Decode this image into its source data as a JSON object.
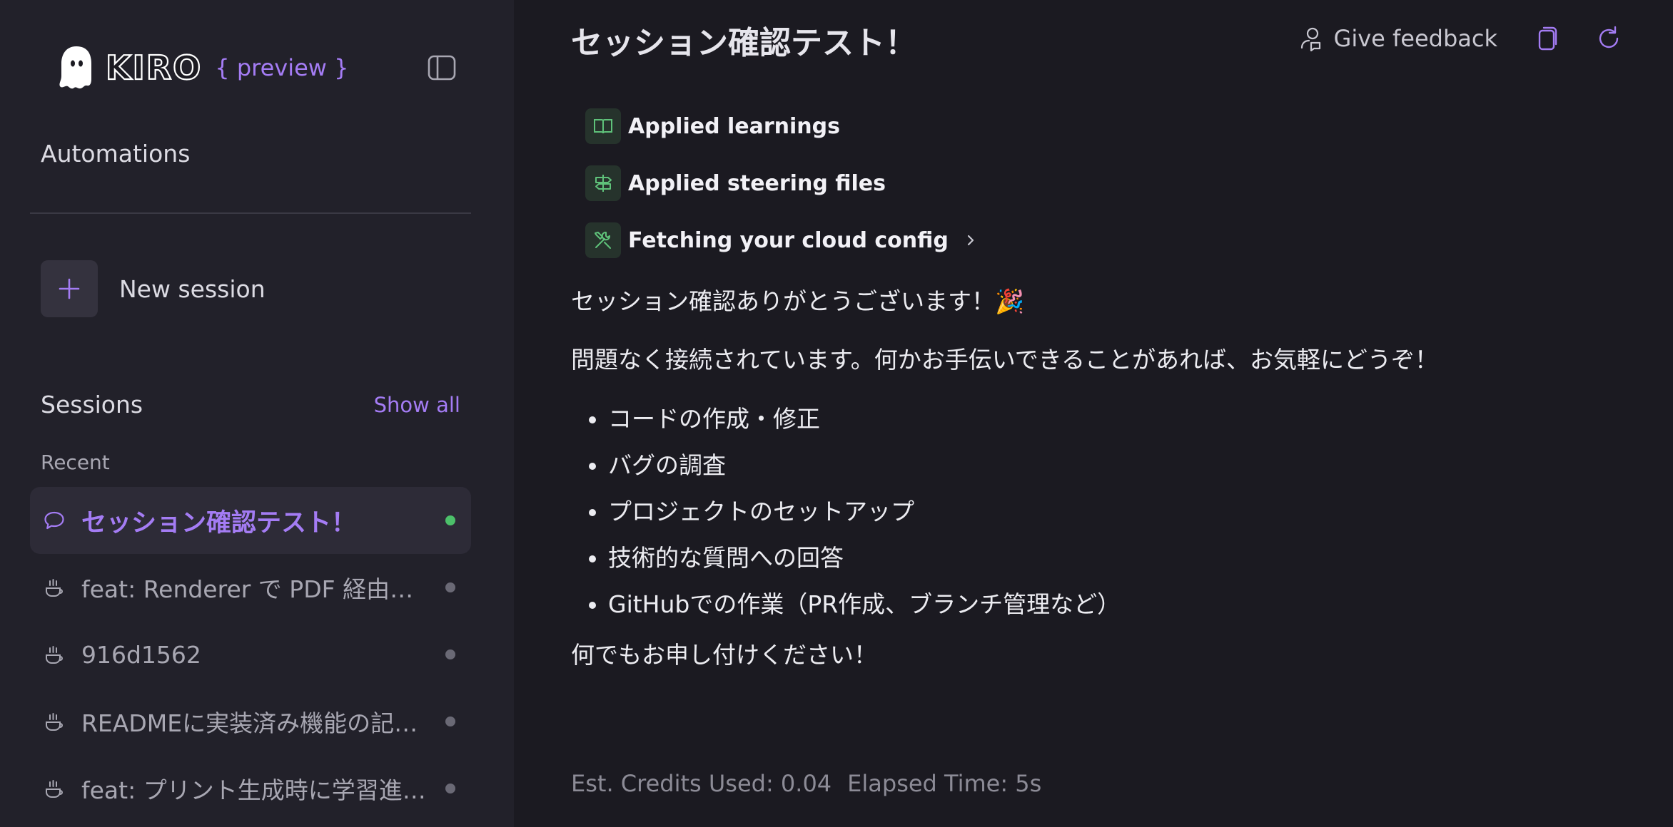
{
  "sidebar": {
    "brand": {
      "name": "KIRO",
      "tag": "{ preview }"
    },
    "automations_label": "Automations",
    "new_session_label": "New session",
    "sessions_title": "Sessions",
    "show_all_label": "Show all",
    "recent_label": "Recent",
    "sessions": [
      {
        "title": "セッション確認テスト！",
        "icon": "chat-bubble-icon",
        "active": true,
        "status": "green"
      },
      {
        "title": "feat: Renderer で PDF 経由の …",
        "icon": "steaming-cup-icon",
        "active": false,
        "status": "gray"
      },
      {
        "title": "916d1562",
        "icon": "steaming-cup-icon",
        "active": false,
        "status": "gray"
      },
      {
        "title": "READMEに実装済み機能の記…",
        "icon": "steaming-cup-icon",
        "active": false,
        "status": "gray"
      },
      {
        "title": "feat: プリント生成時に学習進…",
        "icon": "steaming-cup-icon",
        "active": false,
        "status": "gray"
      }
    ]
  },
  "main": {
    "title": "セッション確認テスト！",
    "feedback_label": "Give feedback",
    "steps": [
      {
        "label": "Applied learnings",
        "icon": "book-icon"
      },
      {
        "label": "Applied steering files",
        "icon": "signpost-icon"
      },
      {
        "label": "Fetching your cloud config",
        "icon": "tools-icon",
        "expandable": true
      }
    ],
    "message": {
      "line1": "セッション確認ありがとうございます！🎉",
      "line2": "問題なく接続されています。何かお手伝いできることがあれば、お気軽にどうぞ！",
      "bullets": [
        "コードの作成・修正",
        "バグの調査",
        "プロジェクトのセットアップ",
        "技術的な質問への回答",
        "GitHubでの作業（PR作成、ブランチ管理など）"
      ],
      "closing": "何でもお申し付けください！"
    },
    "stats": {
      "credits": "Est. Credits Used: 0.04",
      "elapsed": "Elapsed Time: 5s"
    }
  },
  "colors": {
    "accent": "#a47cf4",
    "background": "#1b1a21",
    "sidebar": "#22212a",
    "online": "#4cc06a",
    "step_icon": "#5fc27a"
  }
}
